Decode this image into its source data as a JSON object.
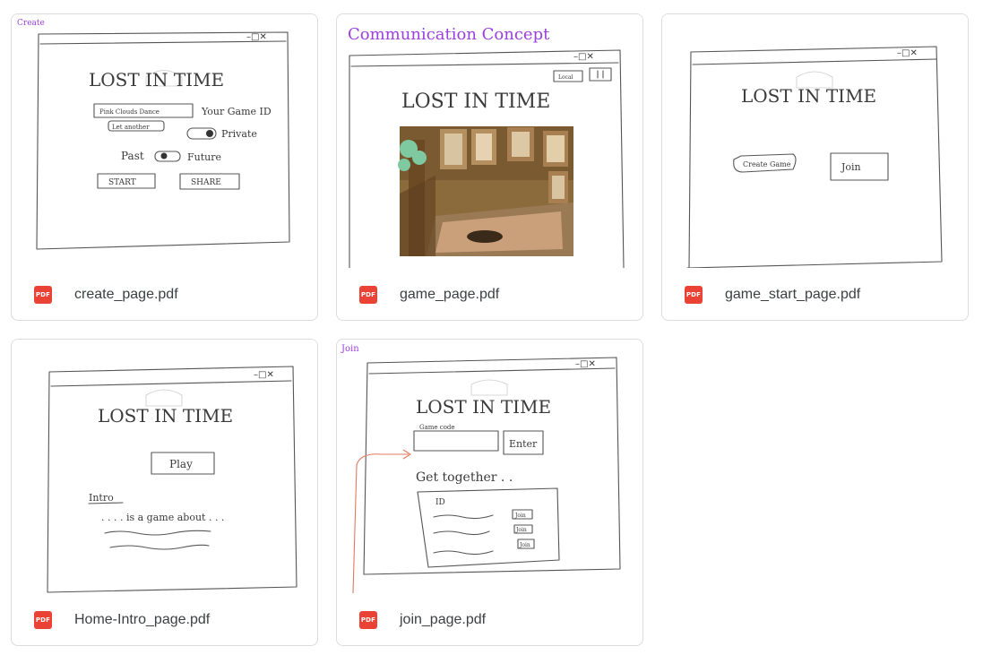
{
  "files": [
    {
      "name": "create_page.pdf",
      "type_badge": "PDF",
      "sketch": {
        "corner_label": "Create",
        "title": "LOST IN TIME",
        "input_value": "Pink Clouds Dance",
        "input_caption": "Your Game ID",
        "link": "Let another",
        "toggle_a": "Private",
        "toggle_b_left": "Past",
        "toggle_b_right": "Future",
        "buttons": [
          "START",
          "SHARE"
        ]
      }
    },
    {
      "name": "game_page.pdf",
      "type_badge": "PDF",
      "sketch": {
        "corner_label": "Communication Concept",
        "title": "LOST IN TIME",
        "small_box": "Local"
      }
    },
    {
      "name": "game_start_page.pdf",
      "type_badge": "PDF",
      "sketch": {
        "title": "LOST IN TIME",
        "buttons": [
          "Create Game",
          "Join"
        ]
      }
    },
    {
      "name": "Home-Intro_page.pdf",
      "type_badge": "PDF",
      "sketch": {
        "title": "LOST IN TIME",
        "button": "Play",
        "section_heading": "Intro",
        "body_text": ". . . . is a game about . . ."
      }
    },
    {
      "name": "join_page.pdf",
      "type_badge": "PDF",
      "sketch": {
        "corner_label": "Join",
        "title": "LOST IN TIME",
        "field_label": "Game code",
        "button": "Enter",
        "section_heading": "Get together . .",
        "column_header": "ID",
        "row_buttons": [
          "Join",
          "Join",
          "Join"
        ]
      }
    }
  ],
  "colors": {
    "card_border": "#dadce0",
    "pdf_badge": "#ea4335",
    "filename_text": "#3c4043",
    "sketch_purple": "#9b3fe0",
    "sketch_arrow": "#e07a5f"
  }
}
